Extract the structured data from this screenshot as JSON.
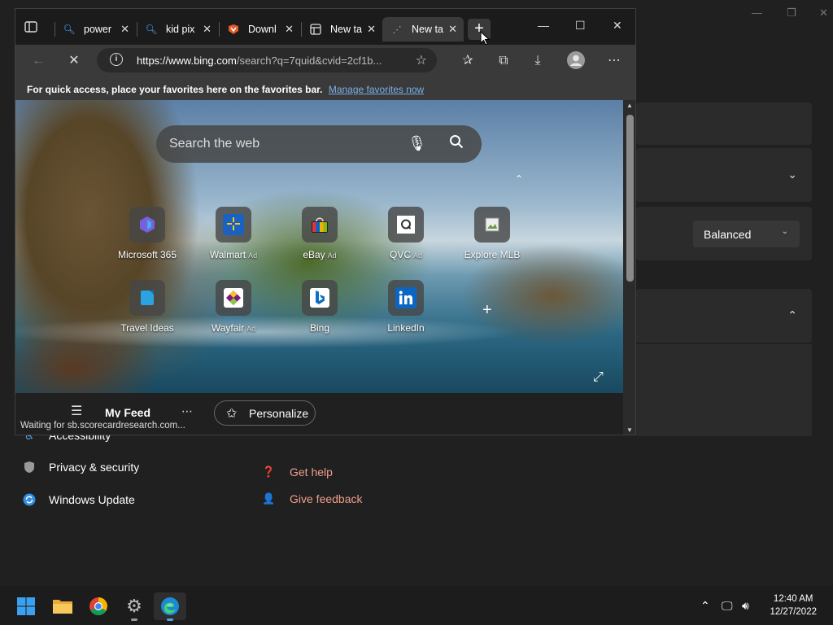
{
  "settings": {
    "power_mode_value": "Balanced",
    "nav": [
      {
        "label": "Accessibility",
        "icon": "accessibility-icon"
      },
      {
        "label": "Privacy & security",
        "icon": "shield-icon"
      },
      {
        "label": "Windows Update",
        "icon": "windows-update-icon"
      }
    ],
    "help_links": [
      {
        "label": "Get help",
        "icon": "help-icon"
      },
      {
        "label": "Give feedback",
        "icon": "feedback-icon"
      }
    ]
  },
  "browser": {
    "tabs": [
      {
        "title": "power",
        "icon": "search-icon",
        "active": false
      },
      {
        "title": "kid pix",
        "icon": "search-icon",
        "active": false
      },
      {
        "title": "Downl",
        "icon": "download-site-icon",
        "active": false
      },
      {
        "title": "New ta",
        "icon": "newtab-page-icon",
        "active": false
      },
      {
        "title": "New ta",
        "icon": "loading-icon",
        "active": true
      }
    ],
    "url_host": "https://www.bing.com",
    "url_rest": "/search?q=7quid&cvid=2cf1b...",
    "favorites_bar_text": "For quick access, place your favorites here on the favorites bar.",
    "favorites_bar_link": "Manage favorites now",
    "search_placeholder": "Search the web",
    "quick_links": [
      {
        "name": "Microsoft 365",
        "ad": ""
      },
      {
        "name": "Walmart",
        "ad": "Ad"
      },
      {
        "name": "eBay",
        "ad": "Ad"
      },
      {
        "name": "QVC",
        "ad": "Ad"
      },
      {
        "name": "Explore MLB",
        "ad": ""
      },
      {
        "name": "Travel Ideas",
        "ad": ""
      },
      {
        "name": "Wayfair",
        "ad": "Ad"
      },
      {
        "name": "Bing",
        "ad": ""
      },
      {
        "name": "LinkedIn",
        "ad": ""
      }
    ],
    "feed_label": "My Feed",
    "personalize_label": "Personalize",
    "status_text": "Waiting for sb.scorecardresearch.com..."
  },
  "taskbar": {
    "apps": [
      "start-icon",
      "file-explorer-icon",
      "chrome-icon",
      "settings-icon",
      "edge-icon"
    ],
    "time": "12:40 AM",
    "date": "12/27/2022"
  },
  "colors": {
    "accent_link": "#7aaee6",
    "help_link": "#f09e8a"
  }
}
